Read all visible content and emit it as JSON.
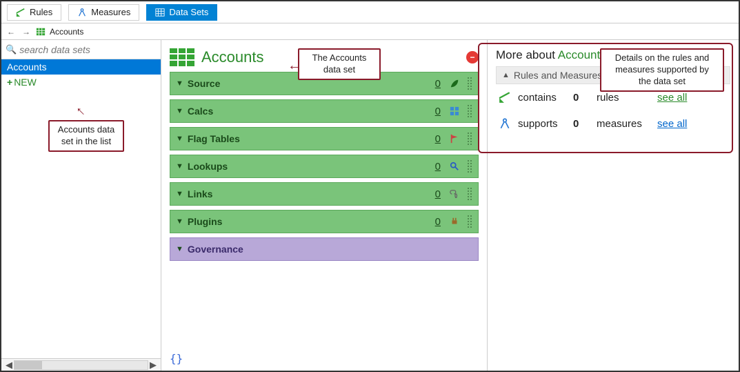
{
  "tabs": {
    "rules": "Rules",
    "measures": "Measures",
    "datasets": "Data Sets"
  },
  "breadcrumb": {
    "item": "Accounts"
  },
  "sidebar": {
    "search_placeholder": "search data sets",
    "items": [
      {
        "label": "Accounts",
        "selected": true
      },
      {
        "label": "NEW",
        "is_new": true
      }
    ]
  },
  "main": {
    "title": "Accounts",
    "sections": [
      {
        "name": "Source",
        "count": "0",
        "icon": "leaf",
        "green": true
      },
      {
        "name": "Calcs",
        "count": "0",
        "icon": "grid",
        "green": true
      },
      {
        "name": "Flag Tables",
        "count": "0",
        "icon": "flag",
        "green": true
      },
      {
        "name": "Lookups",
        "count": "0",
        "icon": "search",
        "green": true
      },
      {
        "name": "Links",
        "count": "0",
        "icon": "link",
        "green": true
      },
      {
        "name": "Plugins",
        "count": "0",
        "icon": "plug",
        "green": true
      },
      {
        "name": "Governance",
        "count": "",
        "icon": "",
        "green": false
      }
    ],
    "brackets": "{}"
  },
  "right": {
    "title_prefix": "More about ",
    "title_accent": "Accounts",
    "subheader": "Rules and Measures",
    "rows": [
      {
        "label": "contains",
        "count": "0",
        "type": "rules",
        "link": "see all",
        "kind": "rules"
      },
      {
        "label": "supports",
        "count": "0",
        "type": "measures",
        "link": "see all",
        "kind": "measures"
      }
    ]
  },
  "callouts": {
    "c1": "The Accounts data set",
    "c2_line1": "Accounts data",
    "c2_line2": "set in the list",
    "c3_line1": "Details on the rules and",
    "c3_line2": "measures supported by",
    "c3_line3": "the data set"
  }
}
